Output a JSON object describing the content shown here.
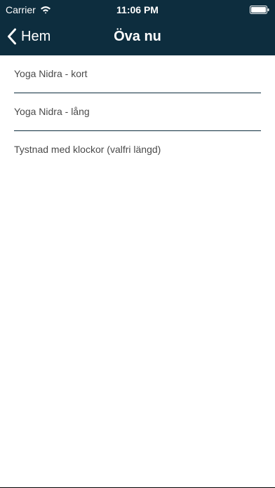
{
  "status_bar": {
    "carrier": "Carrier",
    "time": "11:06 PM",
    "wifi_icon": "wifi-icon",
    "battery_icon": "battery-icon"
  },
  "nav": {
    "back_label": "Hem",
    "back_icon": "chevron-left-icon",
    "title": "Öva nu"
  },
  "list": {
    "items": [
      {
        "label": "Yoga Nidra - kort"
      },
      {
        "label": "Yoga Nidra - lång"
      },
      {
        "label": "Tystnad med klockor (valfri längd)"
      }
    ]
  },
  "colors": {
    "header_background": "#0d2d3e",
    "header_text": "#ffffff",
    "divider": "#0d2d3e",
    "item_text": "#4a4a4a",
    "page_background": "#ffffff"
  }
}
